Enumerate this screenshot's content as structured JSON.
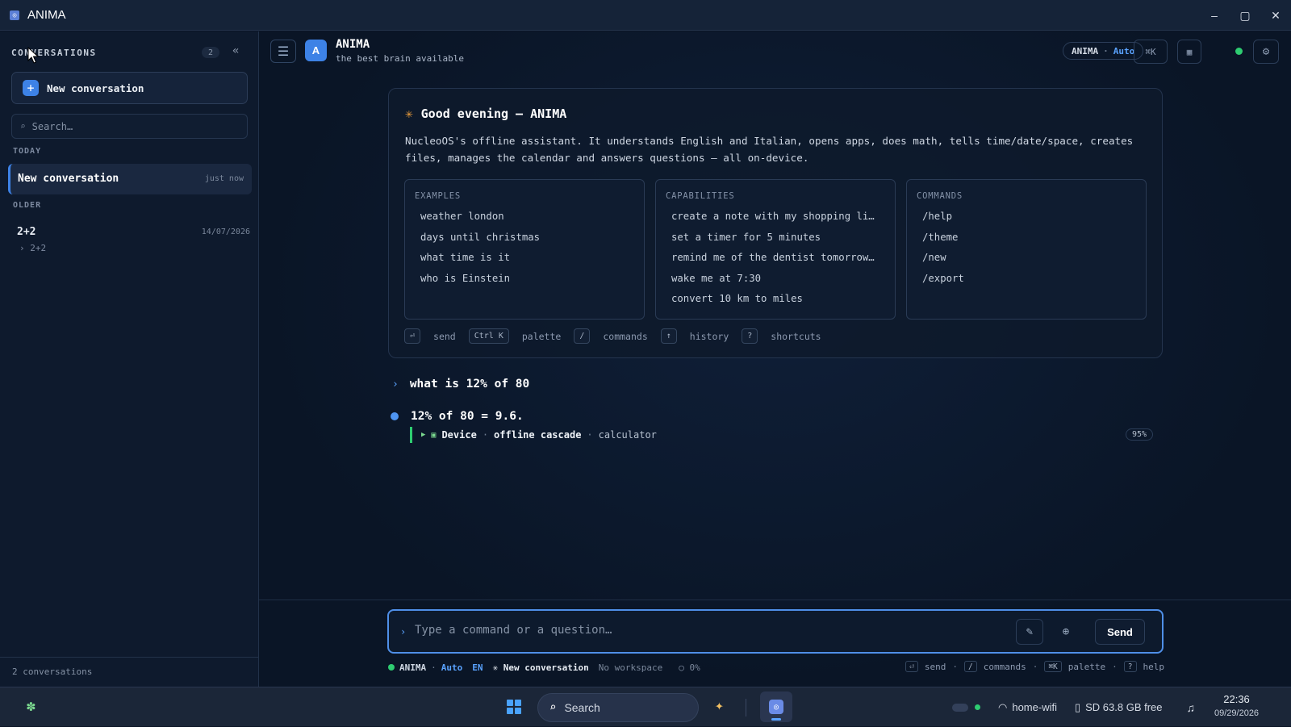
{
  "window": {
    "title": "ANIMA",
    "controls": [
      "–",
      "▢",
      "✕"
    ]
  },
  "sidebar": {
    "header": "CONVERSATIONS",
    "count": "2",
    "collapse_icon": "«",
    "new_button": "New conversation",
    "search_placeholder": "Search…",
    "sections": {
      "today": "TODAY",
      "older": "OLDER"
    },
    "today_items": [
      {
        "title": "New conversation",
        "time": "just now"
      }
    ],
    "older_items": [
      {
        "title": "2+2",
        "date": "14/07/2026",
        "sub": "› 2+2"
      }
    ],
    "footer": "2 conversations"
  },
  "header": {
    "avatar_letter": "A",
    "name": "ANIMA",
    "subtitle": "the best brain available",
    "mode_name": "ANIMA",
    "mode_sep": "·",
    "mode_value": "Auto",
    "palette_shortcut": "⌘K"
  },
  "welcome": {
    "title": "Good evening — ANIMA",
    "description": "NucleoOS's offline assistant. It understands English and Italian, opens apps, does math, tells time/date/space, creates files, manages the calendar and answers questions — all on-device.",
    "cards": [
      {
        "heading": "EXAMPLES",
        "items": [
          "weather london",
          "days until christmas",
          "what time is it",
          "who is Einstein"
        ]
      },
      {
        "heading": "CAPABILITIES",
        "items": [
          "create a note with my shopping li…",
          "set a timer for 5 minutes",
          "remind me of the dentist tomorrow…",
          "wake me at 7:30",
          "convert 10 km to miles"
        ]
      },
      {
        "heading": "COMMANDS",
        "items": [
          "/help",
          "/theme",
          "/new",
          "/export"
        ]
      }
    ],
    "hints": [
      {
        "key": "⏎",
        "label": "send"
      },
      {
        "key": "Ctrl K",
        "label": "palette"
      },
      {
        "key": "/",
        "label": "commands"
      },
      {
        "key": "↑",
        "label": "history"
      },
      {
        "key": "?",
        "label": "shortcuts"
      }
    ]
  },
  "chat": {
    "question": "what is 12% of 80",
    "answer": "12% of 80 = 9.6.",
    "meta": {
      "source": "Device",
      "sep": "·",
      "engine": "offline cascade",
      "tool": "calculator",
      "confidence": "95%"
    }
  },
  "composer": {
    "placeholder": "Type a command or a question…",
    "send_label": "Send"
  },
  "status": {
    "name": "ANIMA",
    "sep": "·",
    "mode": "Auto",
    "lang": "EN",
    "conversation": "New conversation",
    "workspace": "No workspace",
    "progress": "○ 0%",
    "hints": [
      {
        "key": "⏎",
        "label": "send"
      },
      {
        "key": "/",
        "label": "commands"
      },
      {
        "key": "⌘K",
        "label": "palette"
      },
      {
        "key": "?",
        "label": "help"
      }
    ]
  },
  "taskbar": {
    "search": "Search",
    "wifi": "home-wifi",
    "storage": "SD 63.8 GB free",
    "time": "22:36",
    "date": "09/29/2026"
  },
  "colors": {
    "accent": "#3d82e6",
    "online": "#2ecc71",
    "welcome_icon": "#f0a03c"
  },
  "icons": [
    "app-icon",
    "menu-icon",
    "settings-icon",
    "grid-icon",
    "search-icon",
    "wand-icon",
    "globe-icon",
    "wifi-icon",
    "sd-card-icon",
    "bell-icon",
    "copilot-icon",
    "widgets-icon",
    "start-icon"
  ]
}
